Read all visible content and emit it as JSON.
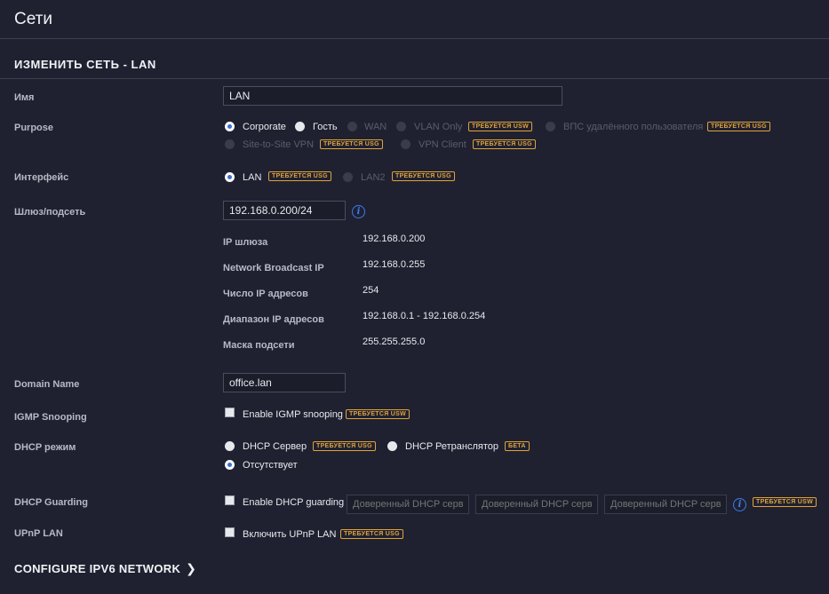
{
  "page": {
    "title": "Сети"
  },
  "section": {
    "title": "ИЗМЕНИТЬ СЕТЬ - LAN"
  },
  "fields": {
    "name": {
      "label": "Имя",
      "value": "LAN"
    },
    "purpose": {
      "label": "Purpose",
      "options": [
        {
          "label": "Corporate",
          "checked": true,
          "disabled": false
        },
        {
          "label": "Гость",
          "checked": false,
          "disabled": false
        },
        {
          "label": "WAN",
          "checked": false,
          "disabled": true
        },
        {
          "label": "VLAN Only",
          "checked": false,
          "disabled": true,
          "badge": "ТРЕБУЕТСЯ USW"
        },
        {
          "label": "ВПС удалённого пользователя",
          "checked": false,
          "disabled": true,
          "badge": "ТРЕБУЕТСЯ USG"
        },
        {
          "label": "Site-to-Site VPN",
          "checked": false,
          "disabled": true,
          "badge": "ТРЕБУЕТСЯ USG"
        },
        {
          "label": "VPN Client",
          "checked": false,
          "disabled": true,
          "badge": "ТРЕБУЕТСЯ USG"
        }
      ]
    },
    "interface": {
      "label": "Интерфейс",
      "options": [
        {
          "label": "LAN",
          "checked": true,
          "disabled": false,
          "badge": "ТРЕБУЕТСЯ USG"
        },
        {
          "label": "LAN2",
          "checked": false,
          "disabled": true,
          "badge": "ТРЕБУЕТСЯ USG"
        }
      ]
    },
    "gateway": {
      "label": "Шлюз/подсеть",
      "value": "192.168.0.200/24",
      "details": [
        {
          "label": "IP шлюза",
          "value": "192.168.0.200"
        },
        {
          "label": "Network Broadcast IP",
          "value": "192.168.0.255"
        },
        {
          "label": "Число IP адресов",
          "value": "254"
        },
        {
          "label": "Диапазон IP адресов",
          "value": "192.168.0.1 - 192.168.0.254"
        },
        {
          "label": "Маска подсети",
          "value": "255.255.255.0"
        }
      ]
    },
    "domain": {
      "label": "Domain Name",
      "value": "office.lan"
    },
    "igmp": {
      "label": "IGMP Snooping",
      "checkbox_label": "Enable IGMP snooping",
      "badge": "ТРЕБУЕТСЯ USW",
      "checked": false
    },
    "dhcp_mode": {
      "label": "DHCP режим",
      "options": [
        {
          "label": "DHCP Сервер",
          "checked": false,
          "badge": "ТРЕБУЕТСЯ USG"
        },
        {
          "label": "DHCP Ретранслятор",
          "checked": false,
          "badge": "БЕТА"
        },
        {
          "label": "Отсутствует",
          "checked": true
        }
      ]
    },
    "dhcp_guarding": {
      "label": "DHCP Guarding",
      "checkbox_label": "Enable DHCP guarding",
      "checked": false,
      "trusted_placeholders": [
        "Доверенный DHCP серв",
        "Доверенный DHCP серв",
        "Доверенный DHCP серв"
      ],
      "badge": "ТРЕБУЕТСЯ USW"
    },
    "upnp": {
      "label": "UPnP LAN",
      "checkbox_label": "Включить UPnP LAN",
      "badge": "ТРЕБУЕТСЯ USG",
      "checked": false
    }
  },
  "ipv6_link": {
    "label": "CONFIGURE IPV6 NETWORK"
  },
  "icons": {
    "info": "info-icon",
    "chevron": "chevron-right-icon"
  },
  "colors": {
    "background": "#1f2130",
    "accent": "#3d7bf0",
    "badge": "#e0a23a"
  }
}
